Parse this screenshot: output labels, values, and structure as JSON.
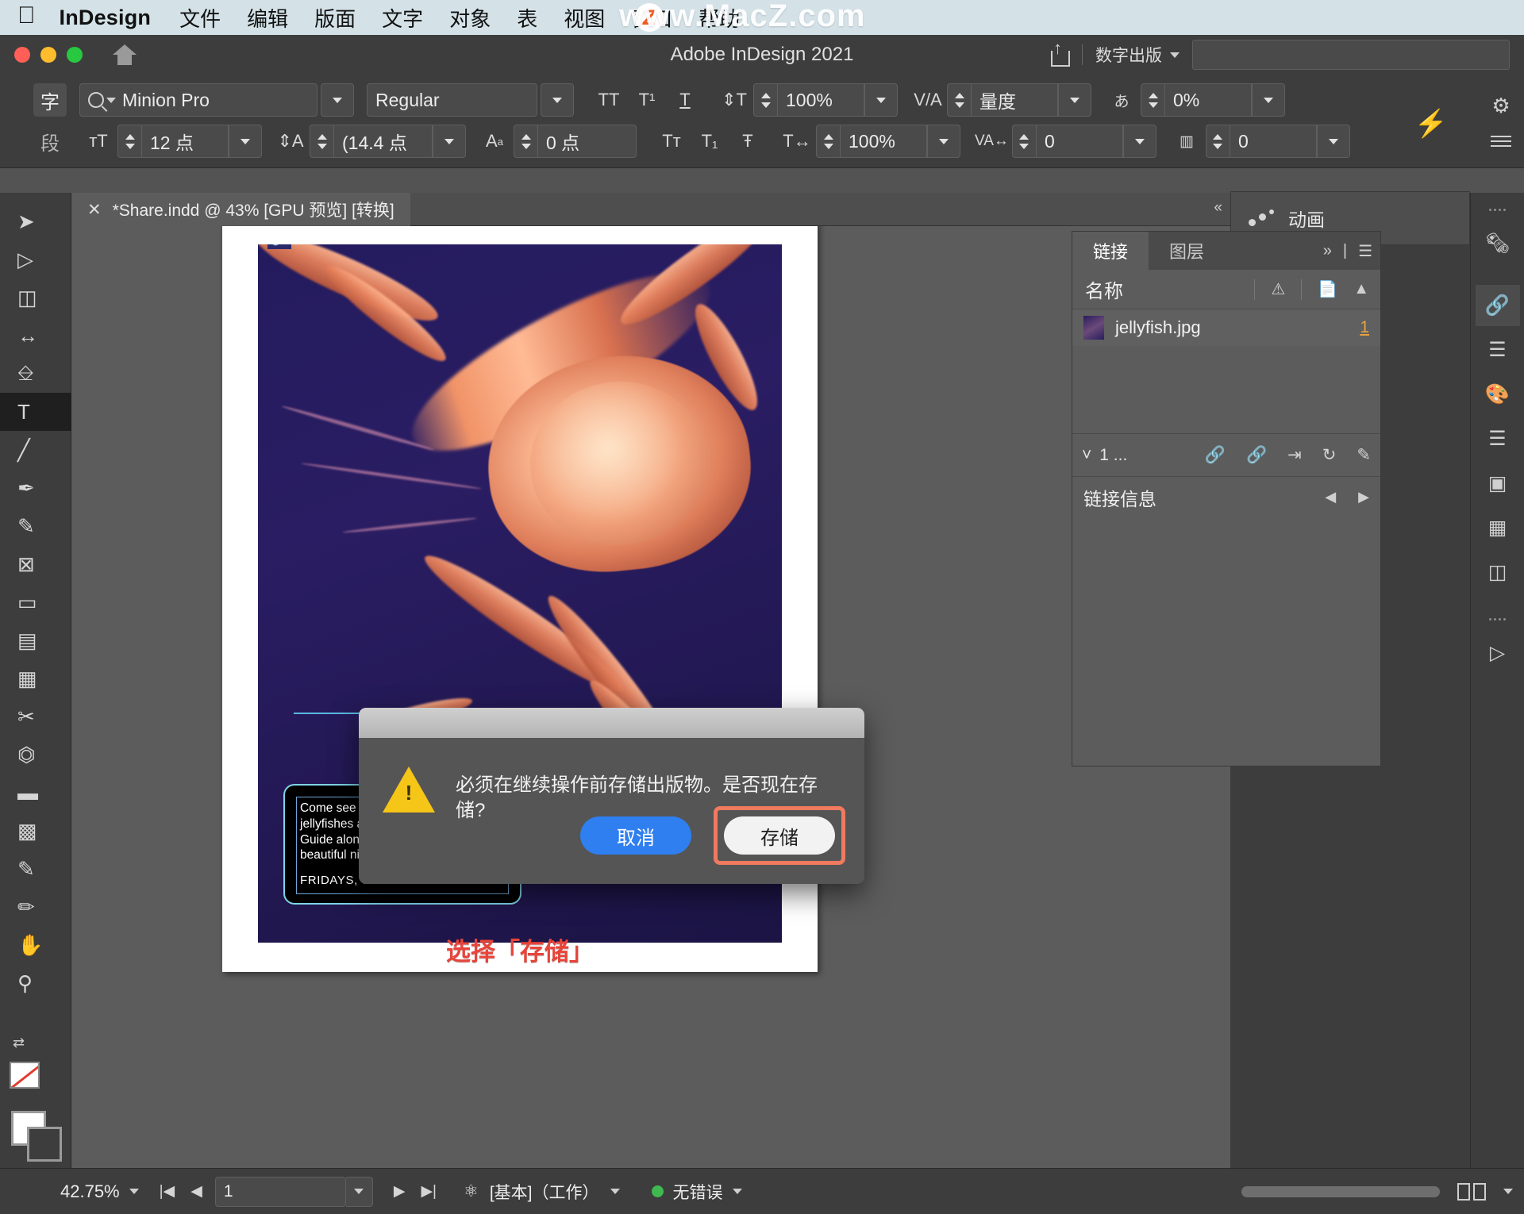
{
  "menubar": {
    "apple_icon": "apple-logo-icon",
    "app_name": "InDesign",
    "items": [
      "文件",
      "编辑",
      "版面",
      "文字",
      "对象",
      "表",
      "视图",
      "窗口",
      "帮助"
    ],
    "watermark": "www.MacZ.com",
    "watermark_badge": "Z"
  },
  "titlebar": {
    "title": "Adobe InDesign 2021",
    "share_icon": "share-icon",
    "home_icon": "home-icon",
    "workspace": "数字出版",
    "search_placeholder": ""
  },
  "control_panel": {
    "mode_char": "字",
    "mode_para": "段",
    "font_family": "Minion Pro",
    "font_style": "Regular",
    "font_size": "12 点",
    "leading": "(14.4 点",
    "baseline_shift": "0 点",
    "vertical_scale": "100%",
    "horizontal_scale": "100%",
    "kerning": "量度",
    "tracking": "0",
    "tsume": "0%",
    "grid_track": "0",
    "btn_all_caps": "TT",
    "btn_superscript": "T¹",
    "btn_underline": "T",
    "btn_small_caps": "Tт",
    "btn_subscript": "T₁",
    "btn_strike": "Ŧ"
  },
  "tabs": {
    "document_label": "*Share.indd @ 43% [GPU 预览] [转换]",
    "close_icon": "close-icon"
  },
  "toolbar": {
    "tools": [
      {
        "name": "selection-tool",
        "glyph": "➤",
        "active": false
      },
      {
        "name": "direct-selection-tool",
        "glyph": "➤",
        "active": false
      },
      {
        "name": "page-tool",
        "glyph": "◳",
        "active": false
      },
      {
        "name": "gap-tool",
        "glyph": "↔",
        "active": false
      },
      {
        "name": "content-collector-tool",
        "glyph": "⛁",
        "active": false
      },
      {
        "name": "type-tool",
        "glyph": "T",
        "active": true
      },
      {
        "name": "line-tool",
        "glyph": "╱",
        "active": false
      },
      {
        "name": "pen-tool",
        "glyph": "✒",
        "active": false
      },
      {
        "name": "pencil-tool",
        "glyph": "✏",
        "active": false
      },
      {
        "name": "frame-tool",
        "glyph": "⊠",
        "active": false
      },
      {
        "name": "rectangle-tool",
        "glyph": "▭",
        "active": false
      },
      {
        "name": "free-transform-tool",
        "glyph": "▤",
        "active": false
      },
      {
        "name": "gradient-swatch-tool",
        "glyph": "▥",
        "active": false
      },
      {
        "name": "scissors-tool",
        "glyph": "✂",
        "active": false
      },
      {
        "name": "gradient-feather-tool",
        "glyph": "◪",
        "active": false
      },
      {
        "name": "gradient-tool",
        "glyph": "▰",
        "active": false
      },
      {
        "name": "note-tool",
        "glyph": "▩",
        "active": false
      },
      {
        "name": "measure-tool",
        "glyph": "▤",
        "active": false
      },
      {
        "name": "color-theme-tool",
        "glyph": "✎",
        "active": false
      },
      {
        "name": "hand-tool",
        "glyph": "✋",
        "active": false
      },
      {
        "name": "zoom-tool",
        "glyph": "🔍",
        "active": false
      }
    ],
    "swap-fill-stroke": "swap-icon"
  },
  "document": {
    "caption_lines": [
      "Come see the world famous",
      "jellyfishes at our weekly Nightwalk",
      "Guide along with the other",
      "beautiful night creatures."
    ],
    "caption_time": "FRIDAYS, 7PM - 9PM",
    "annotation": "选择「存储」",
    "link_badge_icon": "link-badge-icon"
  },
  "dialog": {
    "message": "必须在继续操作前存储出版物。是否现在存储?",
    "warning_icon": "warning-triangle-icon",
    "cancel_label": "取消",
    "save_label": "存储",
    "highlight_color": "#f07a5f",
    "cancel_color": "#2f7ff0"
  },
  "animation_panel": {
    "label": "动画",
    "icon": "animation-dots-icon"
  },
  "links_panel": {
    "tabs": [
      {
        "label": "链接",
        "active": true
      },
      {
        "label": "图层",
        "active": false
      }
    ],
    "column_name": "名称",
    "warning_icon": "warning-icon",
    "page-icon": "page-icon",
    "sort_icon": "sort-icon",
    "expand_icon": "expand-icon",
    "menu_icon": "panel-menu-icon",
    "rows": [
      {
        "filename": "jellyfish.jpg",
        "page": "1"
      }
    ],
    "footer_count": "1 ...",
    "footer_icons": [
      "relink-icon",
      "goto-link-icon",
      "update-link-icon",
      "refresh-icon",
      "edit-original-icon"
    ],
    "info_label": "链接信息",
    "nav_prev": "◀",
    "nav_next": "▶"
  },
  "dock": {
    "icons": [
      "pages-icon",
      "links-icon",
      "layers-icon",
      "color-icon",
      "stroke-icon",
      "effects-icon",
      "object-styles-icon",
      "article-icon",
      "hyperlinks-icon"
    ]
  },
  "statusbar": {
    "zoom": "42.75%",
    "page_value": "1",
    "workspace": "[基本]（工作）",
    "error_status": "无错误",
    "nav_first": "|◀",
    "nav_prev": "◀",
    "nav_next": "▶",
    "nav_last": "▶|",
    "preflight_icon": "preflight-icon",
    "status_dot_color": "#3fb950"
  }
}
